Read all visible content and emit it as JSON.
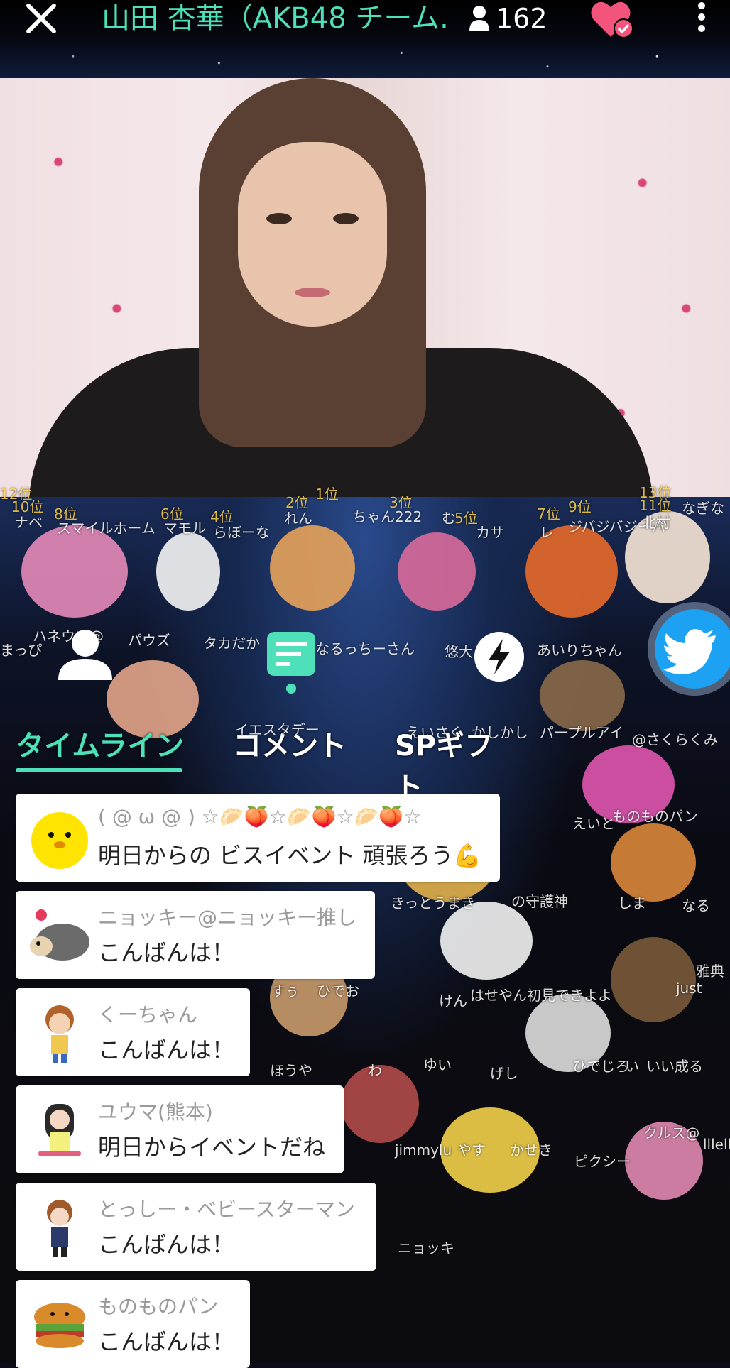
{
  "header": {
    "title": "山田 杏華（AKB48 チーム...",
    "viewer_count": "162"
  },
  "stage": {
    "labels": [
      "ナベ",
      "スマイルホーム",
      "マモル",
      "らぼーな",
      "れん",
      "ちゃん222",
      "む",
      "カサ",
      "レ",
      "ジバジバジーバ",
      "北村",
      "なぎな",
      "まっぴ",
      "ハネウマ@",
      "パウズ",
      "タカだか",
      "なるっちーさん",
      "悠大",
      "あいりちゃん",
      "イエスタデー",
      "えいさく",
      "かしかし",
      "パープルアイ",
      "@さくらくみ",
      "ものものパン",
      "えいと",
      "しま",
      "なる",
      "きっとうまき",
      "の守護神",
      "すぅ",
      "ひでお",
      "けん",
      "はせやん初見できよよ",
      "just",
      "雅典",
      "ほうや",
      "わ",
      "ゆい",
      "げし",
      "ひでじろ",
      "い",
      "いい成る",
      "jimmylu",
      "やす",
      "かせき",
      "ピクシー",
      "クルス@",
      "lllell",
      "ニョッキ"
    ],
    "rank_badges": [
      "12位",
      "10位",
      "8位",
      "6位",
      "4位",
      "2位",
      "1位",
      "3位",
      "5位",
      "7位",
      "9位",
      "11位",
      "13位"
    ]
  },
  "tabs": [
    {
      "label": "タイムライン"
    },
    {
      "label": "コメント"
    },
    {
      "label": "SPギフト"
    }
  ],
  "comments": [
    {
      "user": "( @ ω @ ) ☆🥟🍑☆🥟🍑☆🥟🍑☆",
      "text": "明日からの ビスイベント 頑張ろう💪"
    },
    {
      "user": "ニョッキー@ニョッキー推し",
      "text": "こんばんは！"
    },
    {
      "user": "くーちゃん",
      "text": "こんばんは！"
    },
    {
      "user": "ユウマ(熊本)",
      "text": "明日からイベントだね"
    },
    {
      "user": "とっしー・ベビースターマン",
      "text": "こんばんは！"
    },
    {
      "user": "ものものパン",
      "text": "こんばんは！"
    }
  ],
  "colors": {
    "accent": "#4ee0b8",
    "heart": "#f2547c",
    "twitter": "#1da1f2"
  },
  "icons": {
    "close": "close-icon",
    "viewer": "person-icon",
    "follow": "heart-check-icon",
    "more": "more-vertical-icon",
    "profile": "person-icon",
    "comment": "comment-icon",
    "gift": "lightning-icon",
    "share": "twitter-icon"
  }
}
